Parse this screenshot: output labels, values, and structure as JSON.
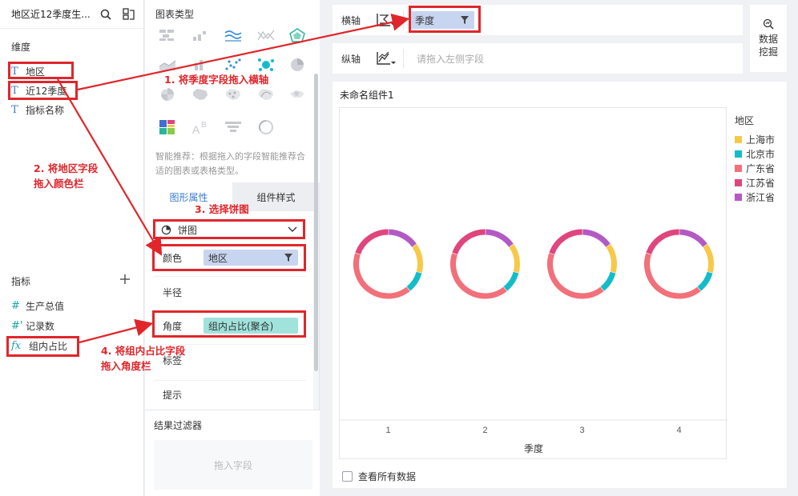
{
  "left_panel": {
    "title": "地区近12季度生...",
    "dimensions_label": "维度",
    "dimensions": [
      "地区",
      "近12季度",
      "指标名称"
    ],
    "measures_label": "指标",
    "measures": [
      "生产总值",
      "记录数",
      "组内占比"
    ],
    "measure_icons": [
      "#",
      "#'",
      "fx"
    ]
  },
  "config_panel": {
    "chart_type_label": "图表类型",
    "hint": "智能推荐：根据拖入的字段智能推荐合适的图表或表格类型。",
    "tabs": [
      "图形属性",
      "组件样式"
    ],
    "chart_select": "饼图",
    "color_label": "颜色",
    "color_field": "地区",
    "radius_label": "半径",
    "angle_label": "角度",
    "angle_field": "组内占比(聚合)",
    "label_label": "标签",
    "tooltip_label": "提示",
    "filter_label": "结果过滤器",
    "filter_placeholder": "拖入字段"
  },
  "axes": {
    "x_label": "横轴",
    "x_field": "季度",
    "y_label": "纵轴",
    "y_placeholder": "请拖入左侧字段"
  },
  "mining_button": [
    "数据",
    "挖掘"
  ],
  "widget": {
    "title": "未命名组件1",
    "show_all_data": "查看所有数据"
  },
  "chart_data": {
    "type": "pie",
    "subtype": "donut",
    "categories": [
      "1",
      "2",
      "3",
      "4"
    ],
    "xlabel": "季度",
    "legend_title": "地区",
    "legend_position": "right",
    "series": [
      {
        "name": "上海市",
        "color": "#f7c84a",
        "values": [
          0.14,
          0.14,
          0.14,
          0.14
        ]
      },
      {
        "name": "北京市",
        "color": "#14bcc9",
        "values": [
          0.1,
          0.1,
          0.1,
          0.1
        ]
      },
      {
        "name": "广东省",
        "color": "#f2707a",
        "values": [
          0.41,
          0.41,
          0.41,
          0.41
        ]
      },
      {
        "name": "江苏省",
        "color": "#e0457e",
        "values": [
          0.2,
          0.2,
          0.2,
          0.2
        ]
      },
      {
        "name": "浙江省",
        "color": "#b359c4",
        "values": [
          0.15,
          0.15,
          0.15,
          0.15
        ]
      }
    ]
  },
  "annotations": [
    "1. 将季度字段拖入横轴",
    "2. 将地区字段",
    "拖入颜色栏",
    "3. 选择饼图",
    "4. 将组内占比字段",
    "拖入角度栏"
  ]
}
